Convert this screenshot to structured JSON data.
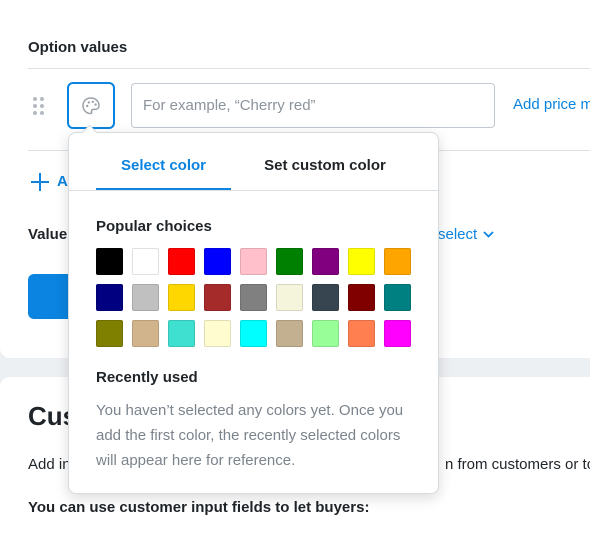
{
  "section": {
    "title": "Option values",
    "input_placeholder": "For example, “Cherry red”",
    "price_link": "Add price m",
    "add_link": "+ A",
    "add_link_text": "A",
    "value_label": "Value",
    "select_link": "select"
  },
  "customization": {
    "heading": "Cus",
    "add_text": "Add in",
    "add_text_tail": "n from customers or to",
    "use_fields": "You can use customer input fields to let buyers:"
  },
  "color_picker": {
    "tabs": [
      {
        "label": "Select color",
        "active": true
      },
      {
        "label": "Set custom color",
        "active": false
      }
    ],
    "popular_heading": "Popular choices",
    "swatches": [
      "#000000",
      "#ffffff",
      "#ff0000",
      "#0000ff",
      "#ffc0cb",
      "#008000",
      "#800080",
      "#ffff00",
      "#ffa500",
      "#000080",
      "#c0c0c0",
      "#ffd700",
      "#a52a2a",
      "#808080",
      "#f5f5dc",
      "#36454f",
      "#800000",
      "#008080",
      "#808000",
      "#d2b48c",
      "#40e0d0",
      "#fffdd0",
      "#00ffff",
      "#c3b091",
      "#98ff98",
      "#ff7f50",
      "#ff00ff"
    ],
    "recent_heading": "Recently used",
    "recent_empty_text": "You haven’t selected any colors yet. Once you add the first color, the recently selected colors will appear here for reference."
  },
  "icons": {
    "drag": "drag-handle-icon",
    "palette": "palette-icon",
    "plus": "plus-icon",
    "chevron": "chevron-down-icon"
  },
  "colors": {
    "accent": "#0a84e0",
    "text": "#1f2429",
    "muted": "#7b838c",
    "background": "#edf0f3"
  }
}
